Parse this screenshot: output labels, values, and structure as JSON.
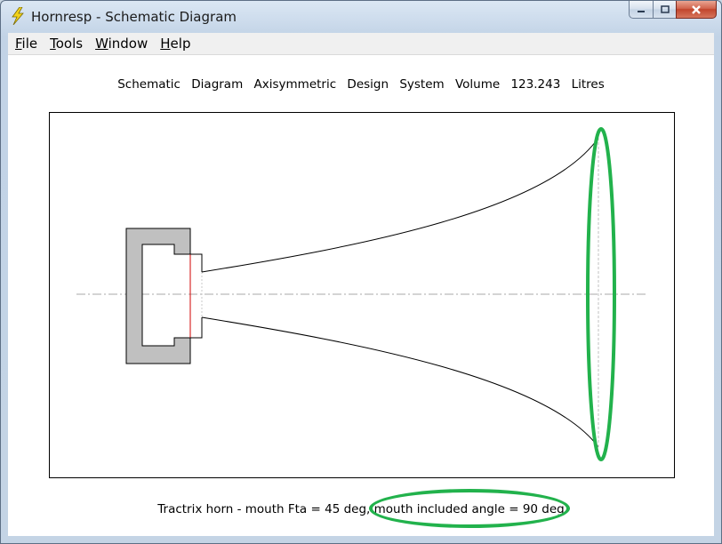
{
  "window": {
    "title": "Hornresp - Schematic Diagram",
    "icon": "lightning-bolt-icon"
  },
  "menu": {
    "file_label": "File",
    "tools_label": "Tools",
    "window_label": "Window",
    "help_label": "Help"
  },
  "header": {
    "text": "Schematic Diagram  Axisymmetric Design  System Volume 123.243 Litres"
  },
  "diagram": {
    "horn_profile": "Tractrix",
    "design": "Axisymmetric",
    "components": [
      "rear-chamber",
      "driver",
      "throat-chamber",
      "horn-flare",
      "mouth",
      "centerline-axis"
    ]
  },
  "caption": {
    "text": "Tractrix horn - mouth Fta = 45 deg, mouth included angle = 90 deg"
  },
  "colors": {
    "highlight": "#22b24c",
    "chamber_fill": "#c0c0c0",
    "driver_line": "#d00000",
    "axis_line": "#b0b0b0"
  }
}
